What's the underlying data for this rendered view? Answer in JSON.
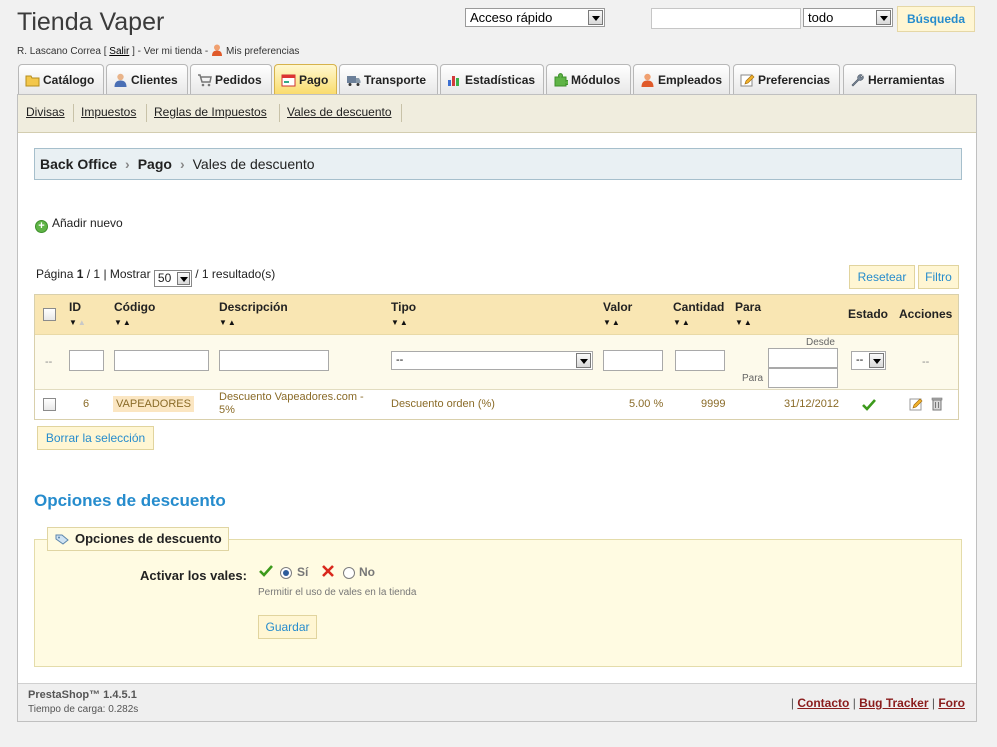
{
  "header": {
    "store_title": "Tienda Vaper",
    "user_name": "R. Lascano Correa",
    "logout": "Salir",
    "view_store": "Ver mi tienda",
    "preferences": "Mis preferencias",
    "quick_access": "Acceso rápido",
    "search_value": "",
    "search_scope": "todo",
    "search_button": "Búsqueda"
  },
  "tabs": [
    {
      "label": "Catálogo",
      "icon": "folder-icon"
    },
    {
      "label": "Clientes",
      "icon": "user-icon"
    },
    {
      "label": "Pedidos",
      "icon": "cart-icon"
    },
    {
      "label": "Pago",
      "icon": "payment-icon",
      "active": true
    },
    {
      "label": "Transporte",
      "icon": "truck-icon"
    },
    {
      "label": "Estadísticas",
      "icon": "chart-icon"
    },
    {
      "label": "Módulos",
      "icon": "puzzle-icon"
    },
    {
      "label": "Empleados",
      "icon": "employee-icon"
    },
    {
      "label": "Preferencias",
      "icon": "pencil-icon"
    },
    {
      "label": "Herramientas",
      "icon": "wrench-icon"
    }
  ],
  "subnav": [
    "Divisas",
    "Impuestos",
    "Reglas de Impuestos",
    "Vales de descuento"
  ],
  "breadcrumb": {
    "root": "Back Office",
    "section": "Pago",
    "page": "Vales de descuento"
  },
  "actions": {
    "add_new": "Añadir nuevo",
    "reset": "Resetear",
    "filter": "Filtro",
    "delete_selection": "Borrar la selección"
  },
  "pager": {
    "page_label": "Página",
    "page": "1",
    "pages": "/ 1",
    "show_label": "| Mostrar",
    "per_page": "50",
    "results": "/ 1 resultado(s)"
  },
  "table": {
    "columns": {
      "id": "ID",
      "code": "Código",
      "description": "Descripción",
      "type": "Tipo",
      "value": "Valor",
      "quantity": "Cantidad",
      "to": "Para",
      "status": "Estado",
      "actions": "Acciones"
    },
    "filters": {
      "placeholder_dash": "--",
      "type_select": "--",
      "from_label": "Desde",
      "to_label": "Para",
      "status_select": "--",
      "actions_dash": "--"
    },
    "rows": [
      {
        "id": "6",
        "code": "VAPEADORES",
        "description": "Descuento Vapeadores.com - 5%",
        "type": "Descuento orden (%)",
        "value": "5.00 %",
        "quantity": "9999",
        "to": "31/12/2012",
        "status": "enabled"
      }
    ]
  },
  "discount_options": {
    "section_title": "Opciones de descuento",
    "legend": "Opciones de descuento",
    "label": "Activar los vales:",
    "yes": "Sí",
    "no": "No",
    "selected": "yes",
    "hint": "Permitir el uso de vales en la tienda",
    "save": "Guardar"
  },
  "footer": {
    "version": "PrestaShop™ 1.4.5.1",
    "load_time": "Tiempo de carga: 0.282s",
    "links": [
      "Contacto",
      "Bug Tracker",
      "Foro"
    ]
  },
  "colors": {
    "accent_blue": "#268ccd",
    "active_tab": "#f9da66",
    "header_row": "#f9e6b3",
    "enabled_green": "#3c9a1c",
    "disabled_red": "#d9281c"
  }
}
